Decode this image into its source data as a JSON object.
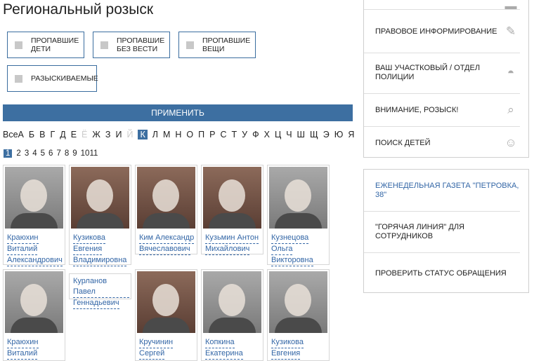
{
  "page": {
    "title": "Региональный розыск"
  },
  "filters": [
    {
      "label": "Пропавшие дети"
    },
    {
      "label": "Пропавшие без вести"
    },
    {
      "label": "Пропавшие вещи"
    },
    {
      "label": "Разыскиваемые"
    }
  ],
  "apply_label": "Применить",
  "alphabet": [
    "ВсеА",
    "Б",
    "В",
    "Г",
    "Д",
    "Е",
    "Ё",
    "Ж",
    "З",
    "И",
    "Й",
    "К",
    "Л",
    "М",
    "Н",
    "О",
    "П",
    "Р",
    "С",
    "Т",
    "У",
    "Ф",
    "Х",
    "Ц",
    "Ч",
    "Ш",
    "Щ",
    "Э",
    "Ю",
    "Я"
  ],
  "alphabet_disabled": [
    "Ё",
    "Й"
  ],
  "alphabet_active": "К",
  "pages": [
    "1",
    "2",
    "3",
    "4",
    "5",
    "6",
    "7",
    "8",
    "9",
    "10",
    "11"
  ],
  "page_active": "1",
  "people": [
    {
      "name": [
        "Краюхин",
        "Виталий",
        "Александрович"
      ]
    },
    {
      "name": [
        "Кузикова",
        "Евгения",
        "Владимировна"
      ]
    },
    {
      "name": [
        "Ким Александр",
        "Вячеславович"
      ]
    },
    {
      "name": [
        "Кузьмин Антон",
        "Михайлович"
      ]
    },
    {
      "name": [
        "Кузнецова",
        "Ольга",
        "Викторовна"
      ]
    },
    {
      "name": [
        "Краюхин",
        "Виталий"
      ]
    },
    {
      "name": [
        "Курланов Павел",
        "Геннадьевич"
      ]
    },
    {
      "name": [
        "Кручинин",
        "Сергей"
      ]
    },
    {
      "name": [
        "Копкина",
        "Екатерина"
      ]
    },
    {
      "name": [
        "Кузикова",
        "Евгения"
      ]
    }
  ],
  "sidebar_top": [
    {
      "label": "Правовое информирование",
      "icon": "document-pen-icon"
    },
    {
      "label": "Ваш участковый / отдел полиции",
      "icon": "police-cap-icon"
    },
    {
      "label": "Внимание, розыск!",
      "icon": "magnifier-icon"
    },
    {
      "label": "Поиск детей",
      "icon": "child-icon"
    }
  ],
  "sidebar_bottom": [
    {
      "label": "Еженедельная газета \"Петровка, 38\"",
      "style": "blue"
    },
    {
      "label": "\"Горячая линия\" для сотрудников",
      "style": "default"
    },
    {
      "label": "Проверить статус обращения",
      "style": "default"
    }
  ],
  "colors": {
    "accent": "#3d6fa1",
    "link": "#3366a6"
  }
}
